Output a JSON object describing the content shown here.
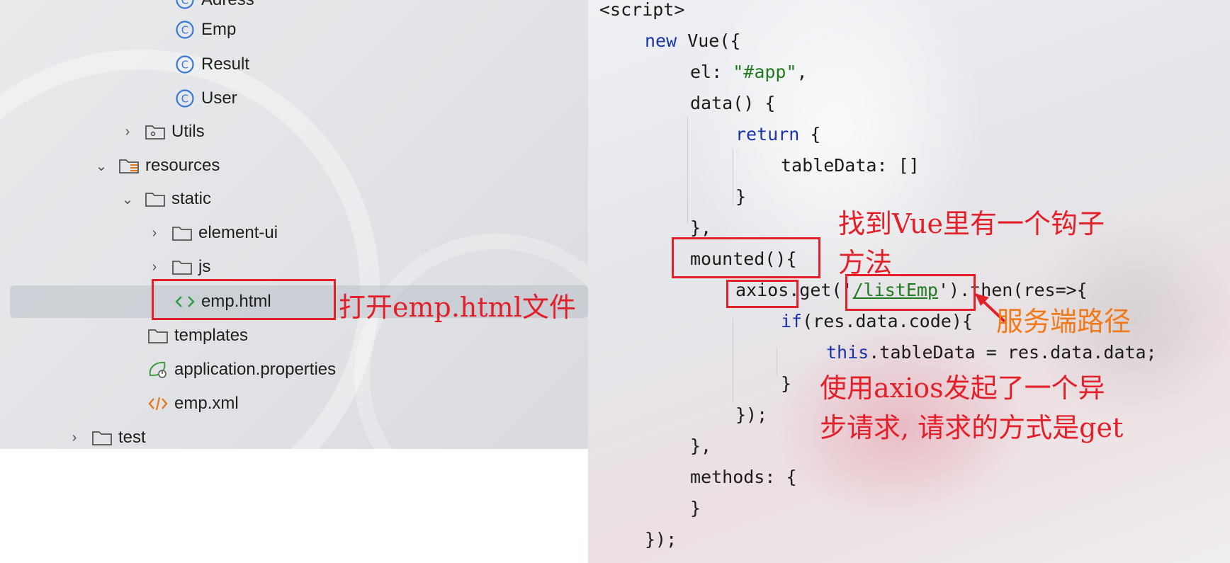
{
  "project_tree": {
    "items": [
      {
        "label": "Adress",
        "icon": "class-icon"
      },
      {
        "label": "Emp",
        "icon": "class-icon"
      },
      {
        "label": "Result",
        "icon": "class-icon"
      },
      {
        "label": "User",
        "icon": "class-icon"
      },
      {
        "label": "Utils",
        "icon": "package-folder-icon",
        "expander": "collapsed"
      },
      {
        "label": "resources",
        "icon": "resources-folder-icon",
        "expander": "expanded"
      },
      {
        "label": "static",
        "icon": "folder-icon",
        "expander": "expanded"
      },
      {
        "label": "element-ui",
        "icon": "folder-icon",
        "expander": "collapsed"
      },
      {
        "label": "js",
        "icon": "folder-icon",
        "expander": "collapsed"
      },
      {
        "label": "emp.html",
        "icon": "html-file-icon",
        "selected": true
      },
      {
        "label": "templates",
        "icon": "folder-icon"
      },
      {
        "label": "application.properties",
        "icon": "spring-properties-icon"
      },
      {
        "label": "emp.xml",
        "icon": "xml-file-icon"
      },
      {
        "label": "test",
        "icon": "folder-icon",
        "expander": "collapsed"
      }
    ]
  },
  "code_editor": {
    "lines": [
      "<script>",
      "new Vue({",
      "el: \"#app\",",
      "data() {",
      "return {",
      "tableData: []",
      "}",
      "},",
      "mounted(){",
      "axios.get('/listEmp').then(res=>{",
      "if(res.data.code){",
      "this.tableData = res.data.data;",
      "}",
      "});",
      "},",
      "methods: {",
      "}",
      "});"
    ]
  },
  "annotations": {
    "open_file": "打开emp.html文件",
    "hook_line1": "找到Vue里有一个钩子",
    "hook_line2": "方法",
    "server_path": "服务端路径",
    "axios_line1": "使用axios发起了一个异",
    "axios_line2": "步请求, 请求的方式是get"
  },
  "colors": {
    "annotation_red": "#e3202a",
    "annotation_orange": "#f07a1a",
    "keyword_blue": "#1a34a8",
    "string_green": "#207a20"
  }
}
